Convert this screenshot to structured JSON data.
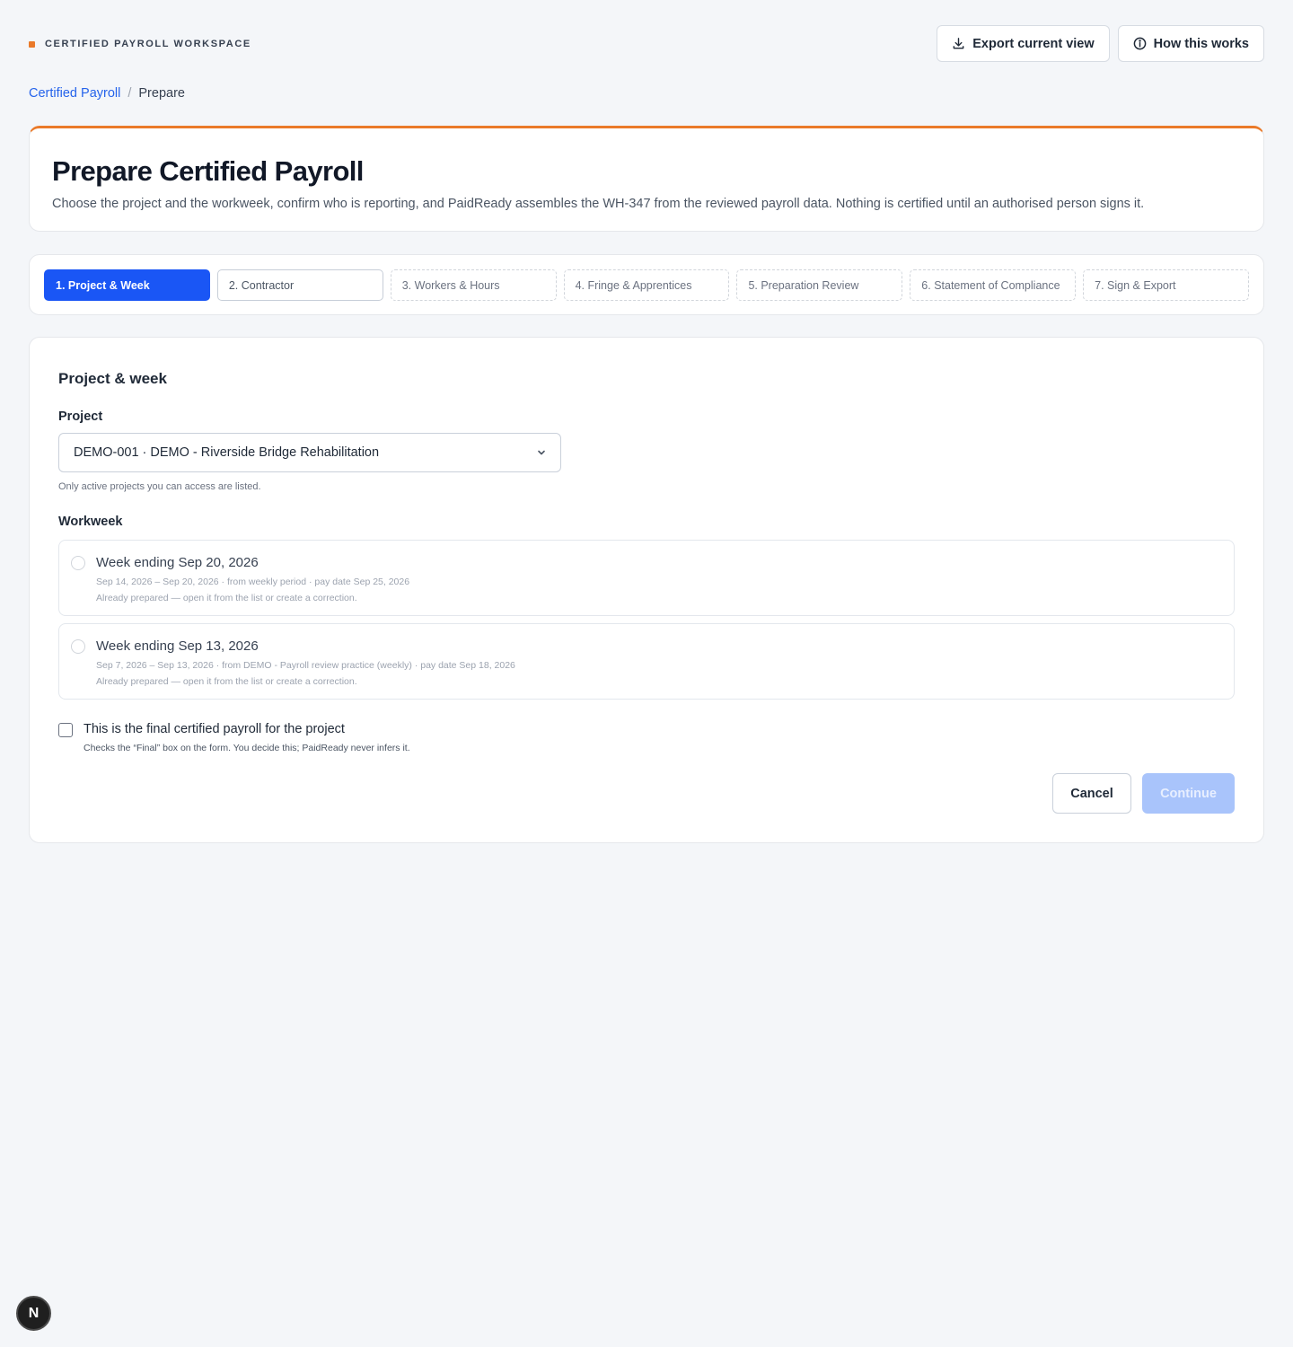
{
  "workspace": {
    "label": "CERTIFIED PAYROLL WORKSPACE",
    "accent": "#ea7a2a"
  },
  "toolbar": {
    "export_label": "Export current view",
    "export_icon": "download-icon",
    "how_label": "How this works",
    "how_icon": "info-icon"
  },
  "breadcrumb": {
    "root": "Certified Payroll",
    "separator": "/",
    "current": "Prepare"
  },
  "header": {
    "title": "Prepare Certified Payroll",
    "description": "Choose the project and the workweek, confirm who is reporting, and PaidReady assembles the WH-347 from the reviewed payroll data. Nothing is certified until an authorised person signs it."
  },
  "steps": [
    {
      "label": "1. Project & Week",
      "state": "active"
    },
    {
      "label": "2. Contractor",
      "state": "next"
    },
    {
      "label": "3. Workers & Hours",
      "state": "pending"
    },
    {
      "label": "4. Fringe & Apprentices",
      "state": "pending"
    },
    {
      "label": "5. Preparation Review",
      "state": "pending"
    },
    {
      "label": "6. Statement of Compliance",
      "state": "pending"
    },
    {
      "label": "7. Sign & Export",
      "state": "pending"
    }
  ],
  "form": {
    "section_title": "Project & week",
    "project_label": "Project",
    "project_value": "DEMO-001 · DEMO - Riverside Bridge Rehabilitation",
    "project_help": "Only active projects you can access are listed.",
    "workweek_label": "Workweek",
    "weeks": [
      {
        "title": "Week ending Sep 20, 2026",
        "meta": "Sep 14, 2026 – Sep 20, 2026 · from weekly period · pay date Sep 25, 2026",
        "note": "Already prepared — open it from the list or create a correction."
      },
      {
        "title": "Week ending Sep 13, 2026",
        "meta": "Sep 7, 2026 – Sep 13, 2026 · from DEMO - Payroll review practice (weekly) · pay date Sep 18, 2026",
        "note": "Already prepared — open it from the list or create a correction."
      }
    ],
    "final_label": "This is the final certified payroll for the project",
    "final_help": "Checks the “Final” box on the form. You decide this; PaidReady never infers it.",
    "cancel_label": "Cancel",
    "continue_label": "Continue"
  },
  "badge": {
    "letter": "N"
  },
  "colors": {
    "primary": "#1a56f5",
    "primary_disabled": "#a9c4fb",
    "link": "#2563eb"
  }
}
